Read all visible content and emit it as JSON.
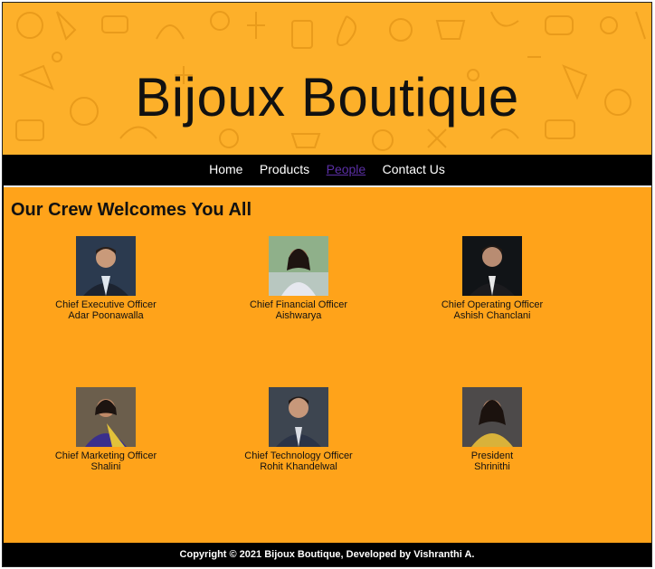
{
  "header": {
    "title": "Bijoux Boutique"
  },
  "nav": {
    "items": [
      {
        "label": "Home"
      },
      {
        "label": "Products"
      },
      {
        "label": "People"
      },
      {
        "label": "Contact Us"
      }
    ]
  },
  "main": {
    "heading": "Our Crew Welcomes You All",
    "crew": [
      {
        "role": "Chief Executive Officer",
        "name": "Adar Poonawalla"
      },
      {
        "role": "Chief Financial Officer",
        "name": "Aishwarya"
      },
      {
        "role": "Chief Operating Officer",
        "name": "Ashish Chanclani"
      },
      {
        "role": "Chief Marketing Officer",
        "name": "Shalini"
      },
      {
        "role": "Chief Technology Officer",
        "name": "Rohit Khandelwal"
      },
      {
        "role": "President",
        "name": "Shrinithi"
      }
    ]
  },
  "footer": {
    "text": "Copyright © 2021 Bijoux Boutique, Developed by Vishranthi A."
  },
  "colors": {
    "banner": "#fdb02a",
    "content_bg": "#ffa31a",
    "nav_bg": "#000000",
    "visited_link": "#5b2fa5"
  }
}
